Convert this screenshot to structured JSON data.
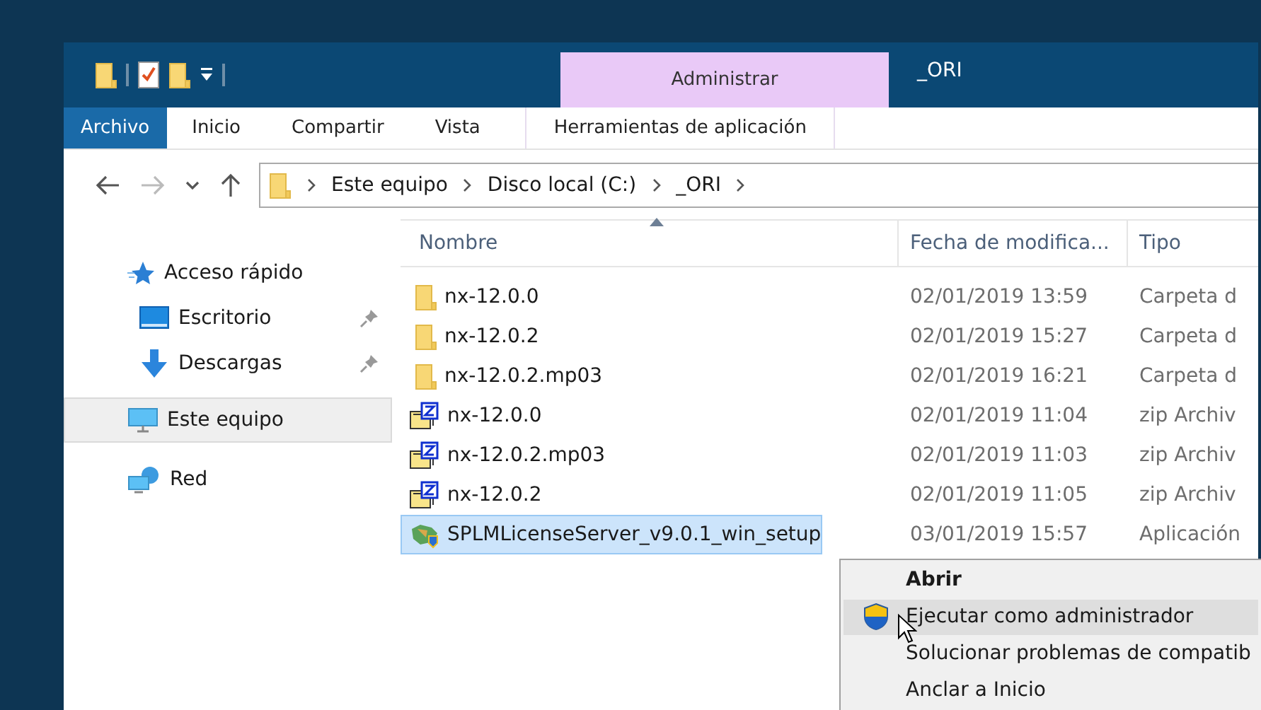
{
  "window": {
    "title": "_ORI"
  },
  "contextual_tab": {
    "label": "Administrar"
  },
  "ribbon_tabs": [
    {
      "label": "Archivo",
      "selected": true
    },
    {
      "label": "Inicio",
      "selected": false
    },
    {
      "label": "Compartir",
      "selected": false
    },
    {
      "label": "Vista",
      "selected": false
    },
    {
      "label": "Herramientas de aplicación",
      "selected": false
    }
  ],
  "address_bar": {
    "path": [
      "Este equipo",
      "Disco local (C:)",
      "_ORI"
    ]
  },
  "nav_pane": {
    "items": [
      {
        "label": "Acceso rápido",
        "kind": "quick",
        "selected": false,
        "children": [
          {
            "label": "Escritorio",
            "kind": "desktop",
            "selected": false,
            "pinned": true
          },
          {
            "label": "Descargas",
            "kind": "downloads",
            "selected": false,
            "pinned": true
          }
        ]
      },
      {
        "label": "Este equipo",
        "kind": "pc",
        "selected": true
      },
      {
        "label": "Red",
        "kind": "network",
        "selected": false
      }
    ]
  },
  "file_list": {
    "columns": [
      {
        "label": "Nombre",
        "sorted": true
      },
      {
        "label": "Fecha de modifica...",
        "sorted": false
      },
      {
        "label": "Tipo",
        "sorted": false
      }
    ],
    "rows": [
      {
        "name": "nx-12.0.0",
        "modified": "02/01/2019 13:59",
        "type": "Carpeta d",
        "kind": "folder",
        "selected": false
      },
      {
        "name": "nx-12.0.2",
        "modified": "02/01/2019 15:27",
        "type": "Carpeta d",
        "kind": "folder",
        "selected": false
      },
      {
        "name": "nx-12.0.2.mp03",
        "modified": "02/01/2019 16:21",
        "type": "Carpeta d",
        "kind": "folder",
        "selected": false
      },
      {
        "name": "nx-12.0.0",
        "modified": "02/01/2019 11:04",
        "type": "zip Archiv",
        "kind": "zip",
        "selected": false
      },
      {
        "name": "nx-12.0.2.mp03",
        "modified": "02/01/2019 11:03",
        "type": "zip Archiv",
        "kind": "zip",
        "selected": false
      },
      {
        "name": "nx-12.0.2",
        "modified": "02/01/2019 11:05",
        "type": "zip Archiv",
        "kind": "zip",
        "selected": false
      },
      {
        "name": "SPLMLicenseServer_v9.0.1_win_setup",
        "modified": "03/01/2019 15:57",
        "type": "Aplicación",
        "kind": "setup",
        "selected": true
      }
    ]
  },
  "context_menu": {
    "items": [
      {
        "label": "Abrir",
        "kind": "plain",
        "default": true,
        "selected": false
      },
      {
        "label": "Ejecutar como administrador",
        "kind": "shield",
        "default": false,
        "selected": true
      },
      {
        "label": "Solucionar problemas de compatib",
        "kind": "plain",
        "default": false,
        "selected": false
      },
      {
        "label": "Anclar a Inicio",
        "kind": "plain",
        "default": false,
        "selected": false
      }
    ]
  }
}
